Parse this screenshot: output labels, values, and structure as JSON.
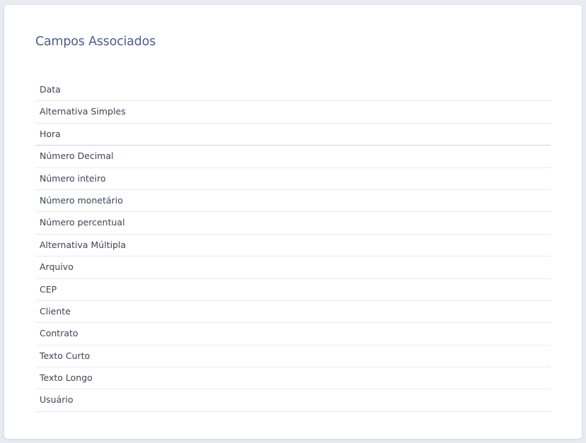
{
  "card": {
    "title": "Campos Associados"
  },
  "fields": [
    {
      "label": "Data"
    },
    {
      "label": "Alternativa Simples"
    },
    {
      "label": "Hora"
    },
    {
      "label": "Número Decimal"
    },
    {
      "label": "Número inteiro"
    },
    {
      "label": "Número monetário"
    },
    {
      "label": "Número percentual"
    },
    {
      "label": "Alternativa Múltipla"
    },
    {
      "label": "Arquivo"
    },
    {
      "label": "CEP"
    },
    {
      "label": "Cliente"
    },
    {
      "label": "Contrato"
    },
    {
      "label": "Texto Curto"
    },
    {
      "label": "Texto Longo"
    },
    {
      "label": "Usuário"
    }
  ],
  "colors": {
    "page_background": "#e9ebf2",
    "card_background": "#ffffff",
    "title": "#4e5d8c",
    "text": "#3d4454",
    "divider": "#e8eaf0"
  }
}
